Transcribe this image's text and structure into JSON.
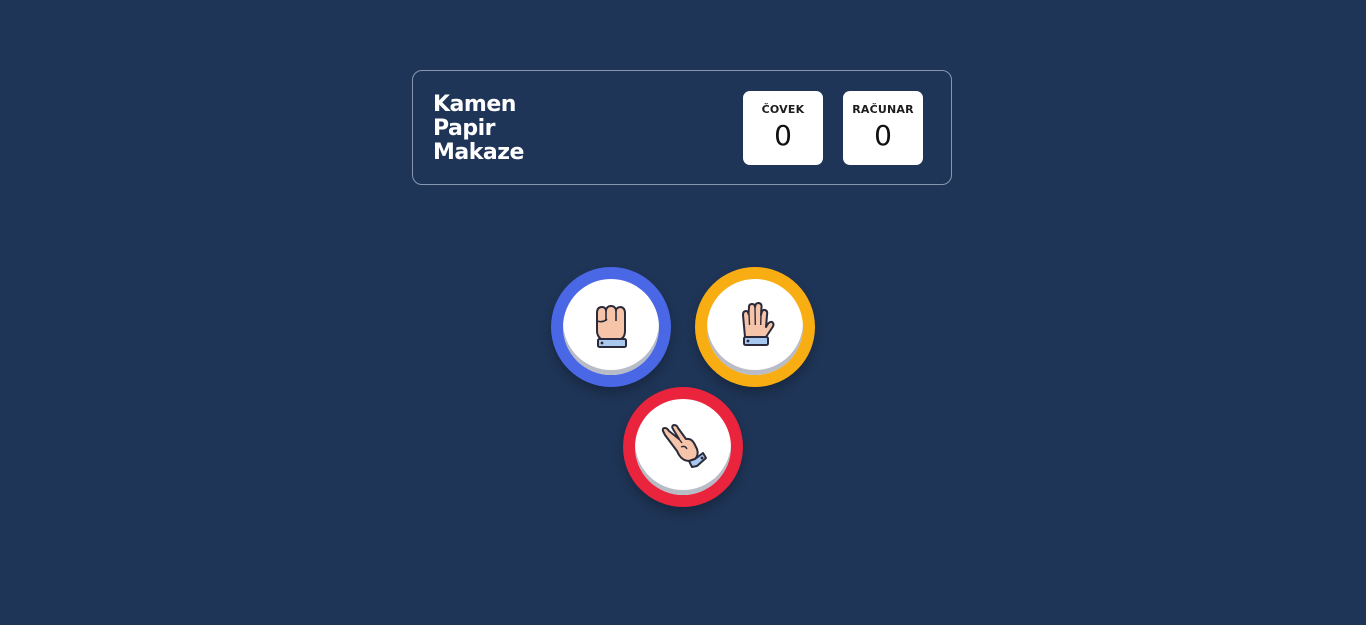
{
  "header": {
    "title_lines": [
      "Kamen",
      "Papir",
      "Makaze"
    ],
    "scores": [
      {
        "label": "ČOVEK",
        "value": "0"
      },
      {
        "label": "RAČUNAR",
        "value": "0"
      }
    ]
  },
  "choices": [
    {
      "id": "rock",
      "icon": "fist-icon",
      "color": "#4a67e6"
    },
    {
      "id": "paper",
      "icon": "open-hand-icon",
      "color": "#f8ad12"
    },
    {
      "id": "scissors",
      "icon": "victory-hand-icon",
      "color": "#e9243c"
    }
  ],
  "colors": {
    "background": "#1f3557",
    "border": "#8797b1"
  }
}
